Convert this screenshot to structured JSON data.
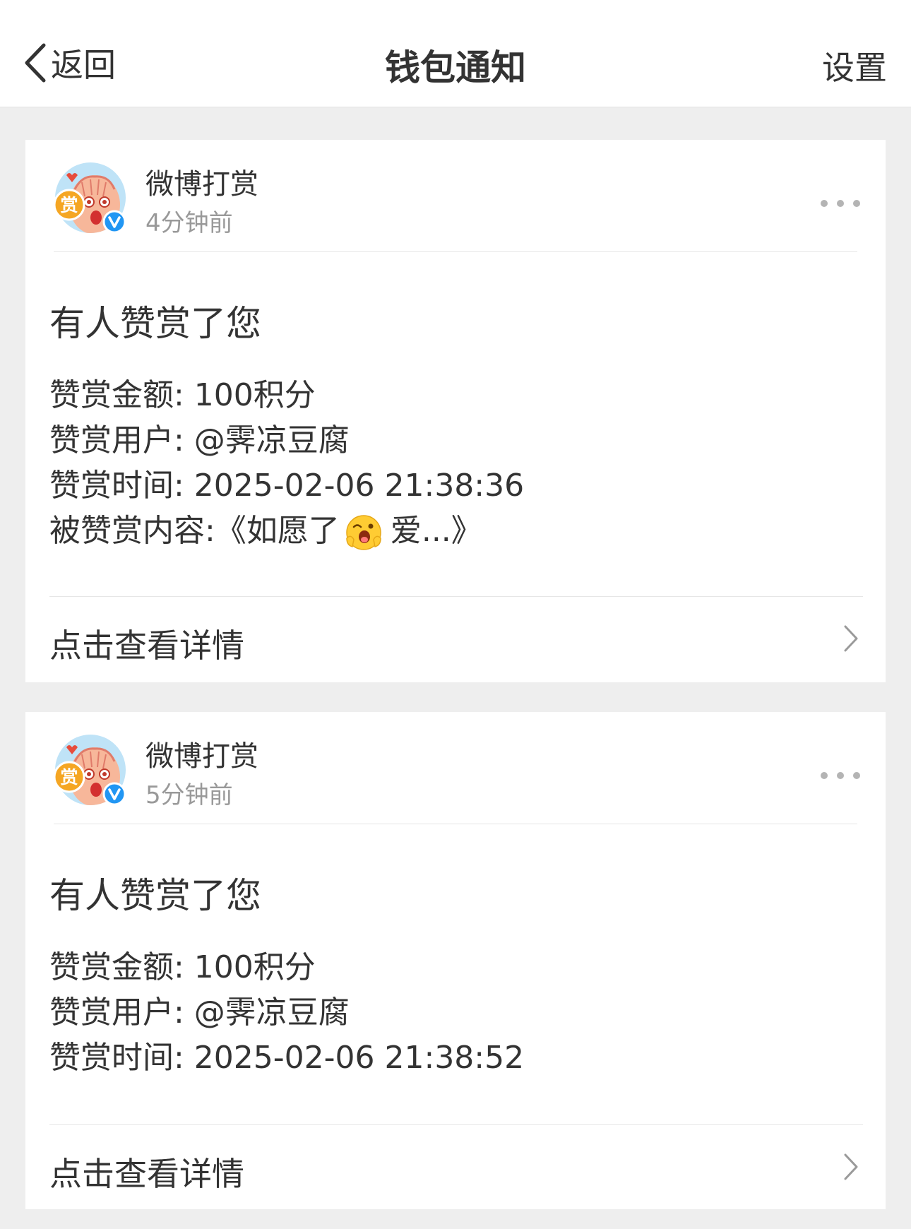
{
  "nav": {
    "back_label": "返回",
    "title": "钱包通知",
    "settings_label": "设置"
  },
  "cards": [
    {
      "sender": "微博打赏",
      "time_ago": "4分钟前",
      "headline": "有人赞赏了您",
      "amount": "赞赏金额: 100积分",
      "user": "赞赏用户: @霁凉豆腐",
      "time": "赞赏时间: 2025-02-06 21:38:36",
      "content_prefix": "被赞赏内容:《如愿了",
      "content_suffix": "爱...》",
      "view_label": "点击查看详情"
    },
    {
      "sender": "微博打赏",
      "time_ago": "5分钟前",
      "headline": "有人赞赏了您",
      "amount": "赞赏金额: 100积分",
      "user": "赞赏用户: @霁凉豆腐",
      "time": "赞赏时间: 2025-02-06 21:38:52",
      "view_label": "点击查看详情"
    }
  ],
  "avatar_badge": "赏",
  "colors": {
    "nav_bg": "#ffffff",
    "page_bg": "#eeeeee",
    "text": "#333333",
    "muted": "#999999",
    "verified": "#2196f3",
    "badge": "#f5a623"
  }
}
